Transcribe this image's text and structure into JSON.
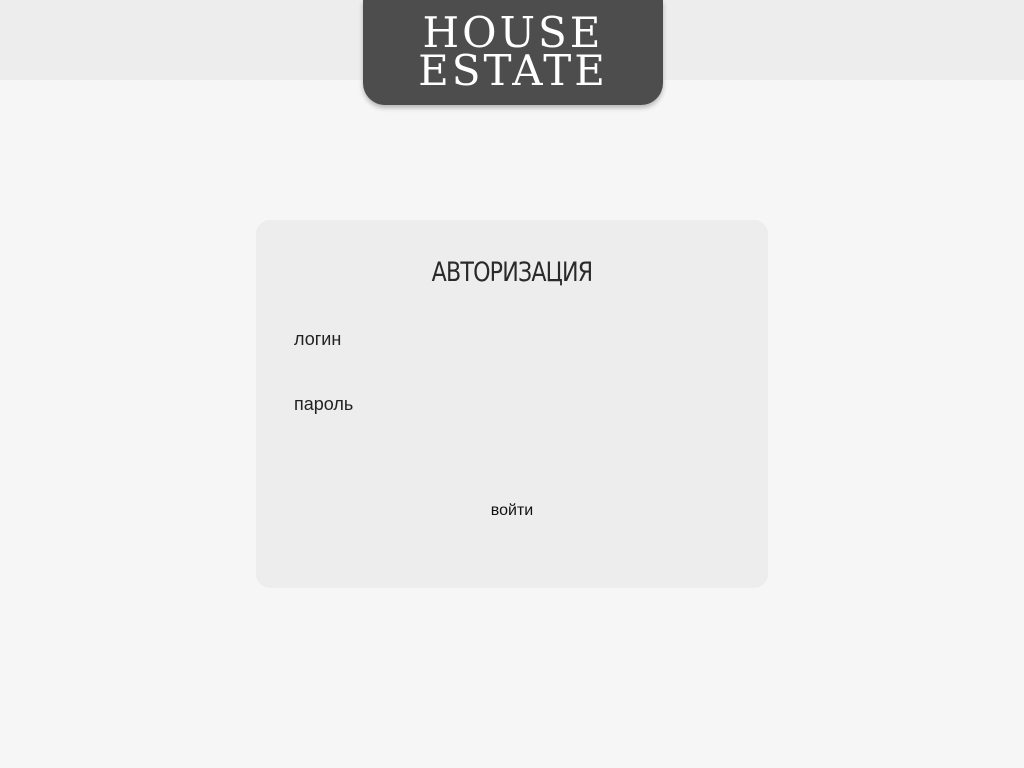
{
  "header": {
    "logo_line_1": "HOUSE",
    "logo_line_2": "ESTATE"
  },
  "login_form": {
    "title": "АВТОРИЗАЦИЯ",
    "login_label": "логин",
    "login_value": "",
    "password_label": "пароль",
    "password_value": "",
    "submit_label": "войти"
  }
}
